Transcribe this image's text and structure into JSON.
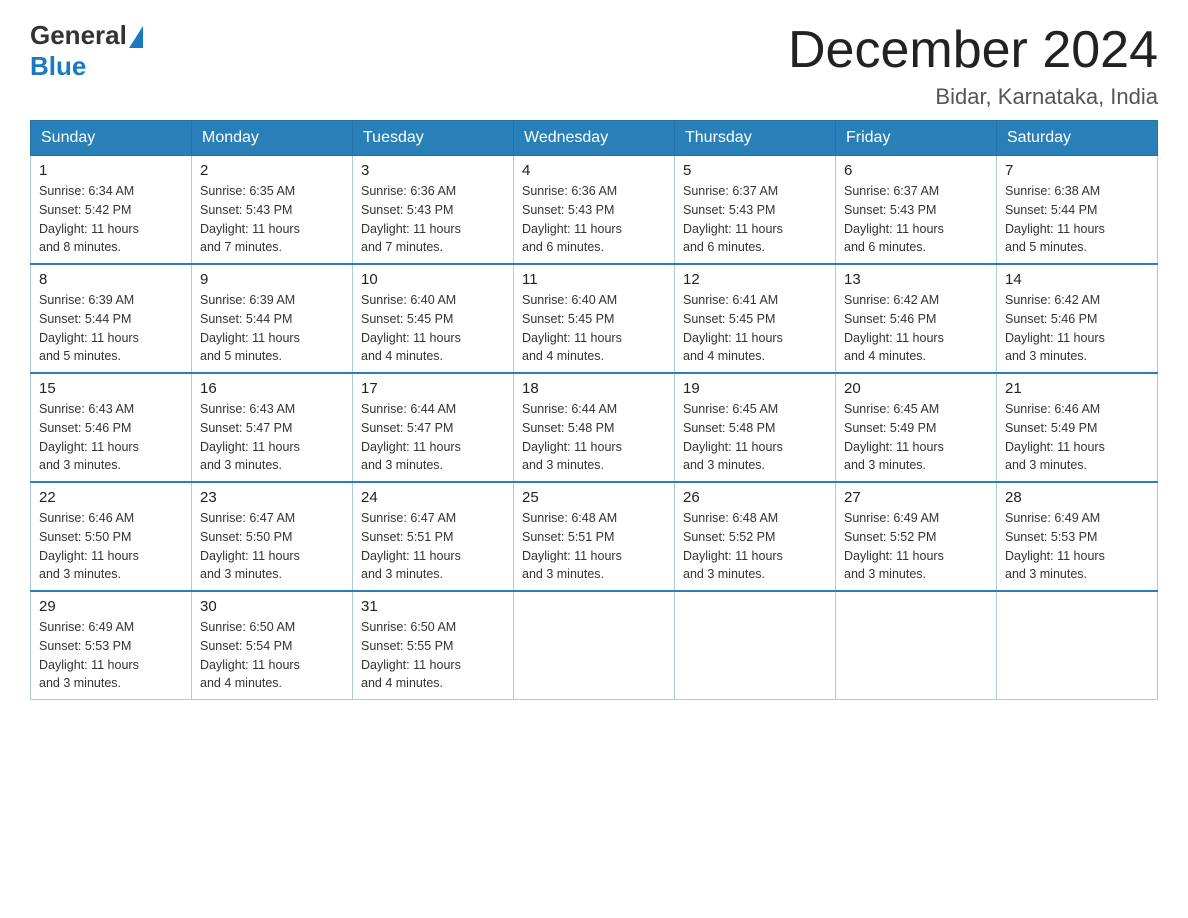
{
  "header": {
    "logo_general": "General",
    "logo_blue": "Blue",
    "title": "December 2024",
    "subtitle": "Bidar, Karnataka, India"
  },
  "weekdays": [
    "Sunday",
    "Monday",
    "Tuesday",
    "Wednesday",
    "Thursday",
    "Friday",
    "Saturday"
  ],
  "weeks": [
    [
      {
        "day": "1",
        "sunrise": "6:34 AM",
        "sunset": "5:42 PM",
        "daylight": "11 hours and 8 minutes."
      },
      {
        "day": "2",
        "sunrise": "6:35 AM",
        "sunset": "5:43 PM",
        "daylight": "11 hours and 7 minutes."
      },
      {
        "day": "3",
        "sunrise": "6:36 AM",
        "sunset": "5:43 PM",
        "daylight": "11 hours and 7 minutes."
      },
      {
        "day": "4",
        "sunrise": "6:36 AM",
        "sunset": "5:43 PM",
        "daylight": "11 hours and 6 minutes."
      },
      {
        "day": "5",
        "sunrise": "6:37 AM",
        "sunset": "5:43 PM",
        "daylight": "11 hours and 6 minutes."
      },
      {
        "day": "6",
        "sunrise": "6:37 AM",
        "sunset": "5:43 PM",
        "daylight": "11 hours and 6 minutes."
      },
      {
        "day": "7",
        "sunrise": "6:38 AM",
        "sunset": "5:44 PM",
        "daylight": "11 hours and 5 minutes."
      }
    ],
    [
      {
        "day": "8",
        "sunrise": "6:39 AM",
        "sunset": "5:44 PM",
        "daylight": "11 hours and 5 minutes."
      },
      {
        "day": "9",
        "sunrise": "6:39 AM",
        "sunset": "5:44 PM",
        "daylight": "11 hours and 5 minutes."
      },
      {
        "day": "10",
        "sunrise": "6:40 AM",
        "sunset": "5:45 PM",
        "daylight": "11 hours and 4 minutes."
      },
      {
        "day": "11",
        "sunrise": "6:40 AM",
        "sunset": "5:45 PM",
        "daylight": "11 hours and 4 minutes."
      },
      {
        "day": "12",
        "sunrise": "6:41 AM",
        "sunset": "5:45 PM",
        "daylight": "11 hours and 4 minutes."
      },
      {
        "day": "13",
        "sunrise": "6:42 AM",
        "sunset": "5:46 PM",
        "daylight": "11 hours and 4 minutes."
      },
      {
        "day": "14",
        "sunrise": "6:42 AM",
        "sunset": "5:46 PM",
        "daylight": "11 hours and 3 minutes."
      }
    ],
    [
      {
        "day": "15",
        "sunrise": "6:43 AM",
        "sunset": "5:46 PM",
        "daylight": "11 hours and 3 minutes."
      },
      {
        "day": "16",
        "sunrise": "6:43 AM",
        "sunset": "5:47 PM",
        "daylight": "11 hours and 3 minutes."
      },
      {
        "day": "17",
        "sunrise": "6:44 AM",
        "sunset": "5:47 PM",
        "daylight": "11 hours and 3 minutes."
      },
      {
        "day": "18",
        "sunrise": "6:44 AM",
        "sunset": "5:48 PM",
        "daylight": "11 hours and 3 minutes."
      },
      {
        "day": "19",
        "sunrise": "6:45 AM",
        "sunset": "5:48 PM",
        "daylight": "11 hours and 3 minutes."
      },
      {
        "day": "20",
        "sunrise": "6:45 AM",
        "sunset": "5:49 PM",
        "daylight": "11 hours and 3 minutes."
      },
      {
        "day": "21",
        "sunrise": "6:46 AM",
        "sunset": "5:49 PM",
        "daylight": "11 hours and 3 minutes."
      }
    ],
    [
      {
        "day": "22",
        "sunrise": "6:46 AM",
        "sunset": "5:50 PM",
        "daylight": "11 hours and 3 minutes."
      },
      {
        "day": "23",
        "sunrise": "6:47 AM",
        "sunset": "5:50 PM",
        "daylight": "11 hours and 3 minutes."
      },
      {
        "day": "24",
        "sunrise": "6:47 AM",
        "sunset": "5:51 PM",
        "daylight": "11 hours and 3 minutes."
      },
      {
        "day": "25",
        "sunrise": "6:48 AM",
        "sunset": "5:51 PM",
        "daylight": "11 hours and 3 minutes."
      },
      {
        "day": "26",
        "sunrise": "6:48 AM",
        "sunset": "5:52 PM",
        "daylight": "11 hours and 3 minutes."
      },
      {
        "day": "27",
        "sunrise": "6:49 AM",
        "sunset": "5:52 PM",
        "daylight": "11 hours and 3 minutes."
      },
      {
        "day": "28",
        "sunrise": "6:49 AM",
        "sunset": "5:53 PM",
        "daylight": "11 hours and 3 minutes."
      }
    ],
    [
      {
        "day": "29",
        "sunrise": "6:49 AM",
        "sunset": "5:53 PM",
        "daylight": "11 hours and 3 minutes."
      },
      {
        "day": "30",
        "sunrise": "6:50 AM",
        "sunset": "5:54 PM",
        "daylight": "11 hours and 4 minutes."
      },
      {
        "day": "31",
        "sunrise": "6:50 AM",
        "sunset": "5:55 PM",
        "daylight": "11 hours and 4 minutes."
      },
      null,
      null,
      null,
      null
    ]
  ],
  "labels": {
    "sunrise": "Sunrise:",
    "sunset": "Sunset:",
    "daylight": "Daylight:"
  }
}
